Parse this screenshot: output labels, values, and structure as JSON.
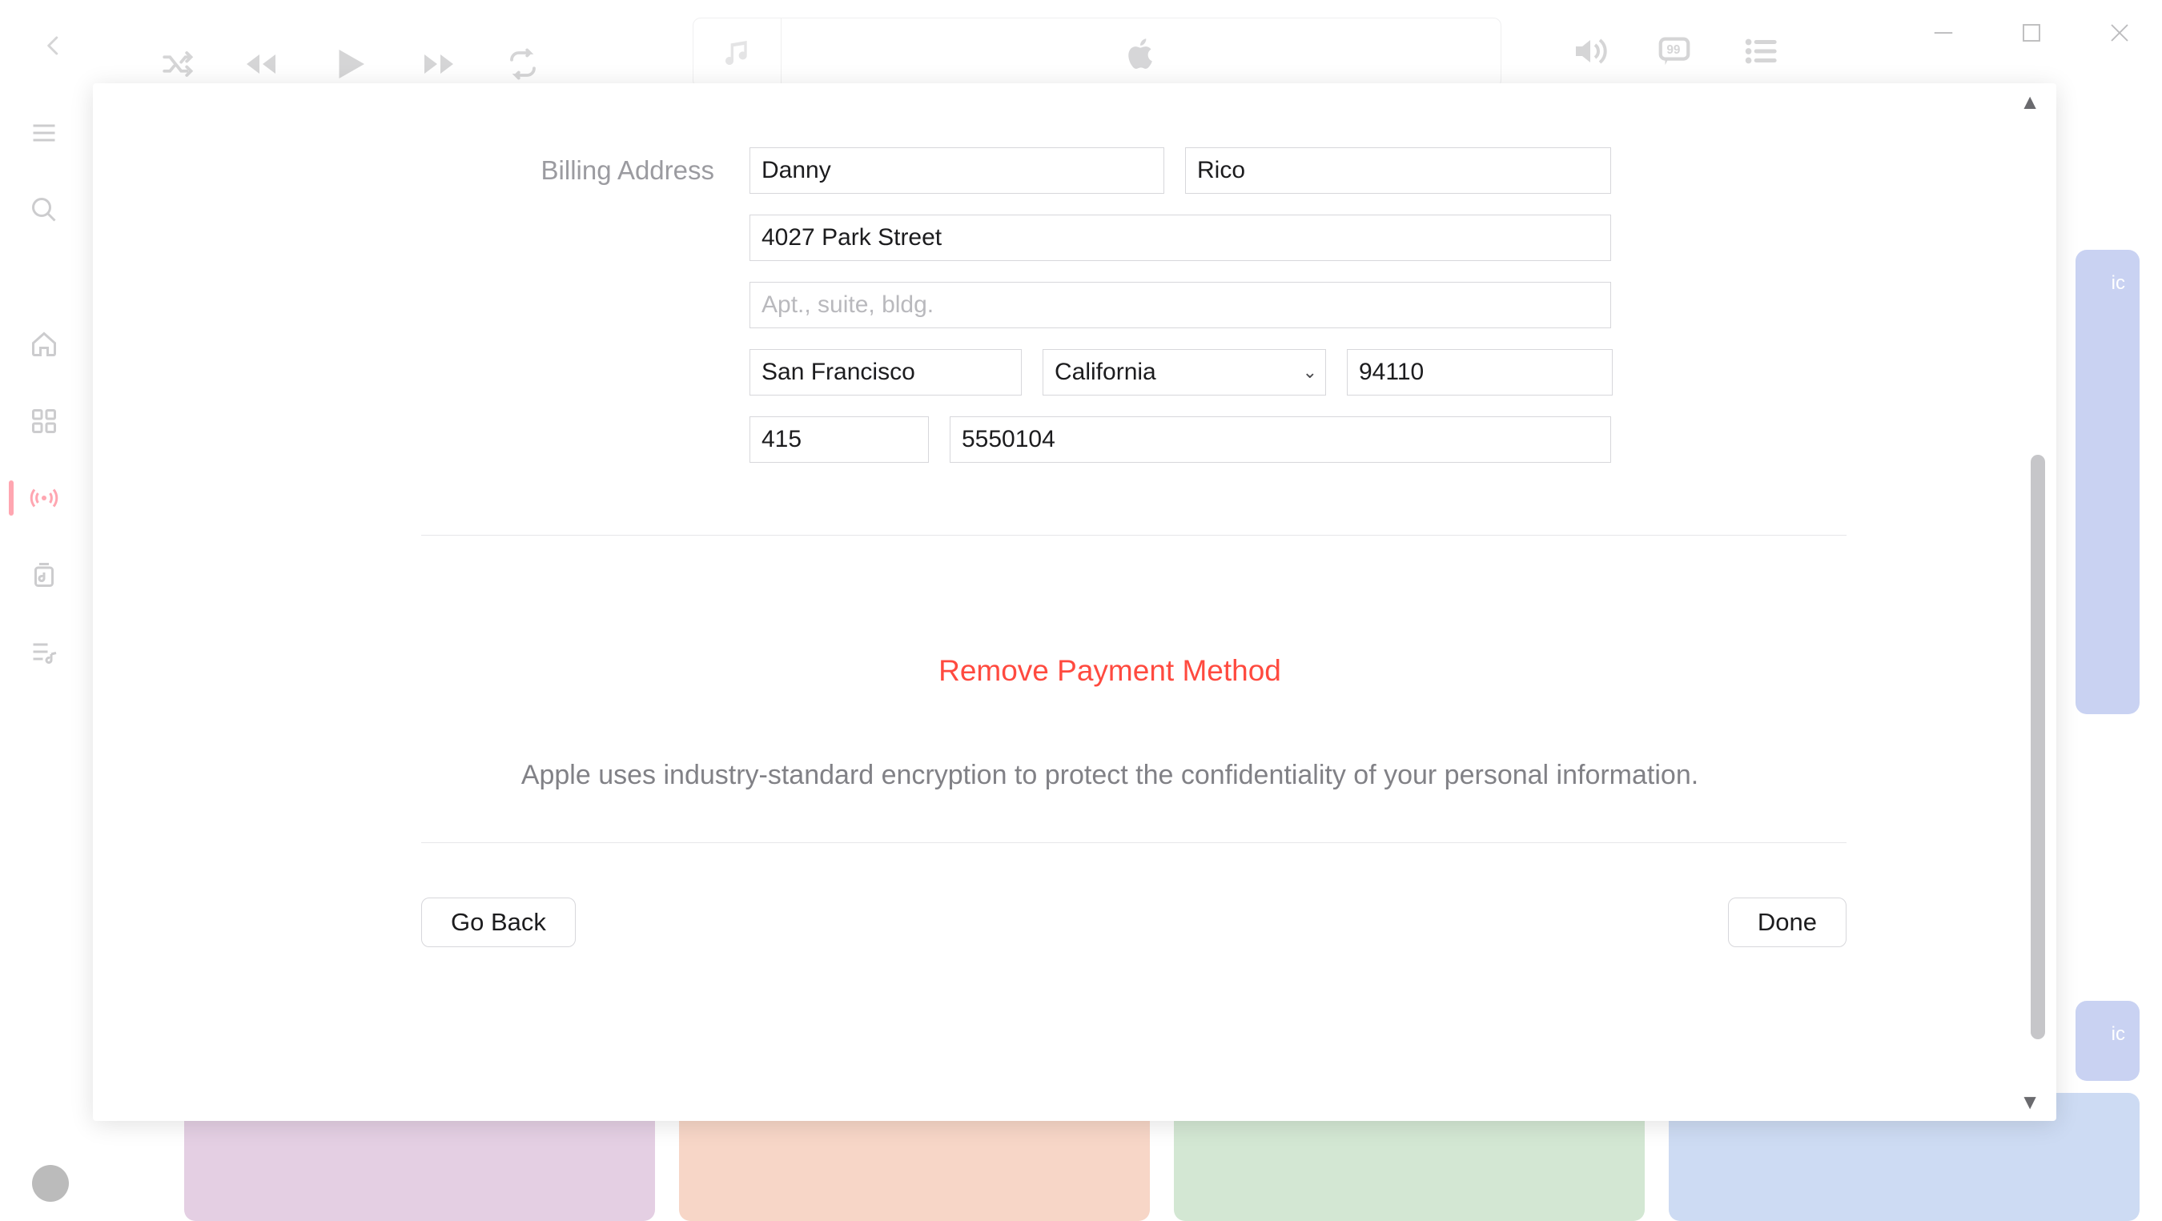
{
  "billing": {
    "section_label": "Billing Address",
    "first_name": "Danny",
    "last_name": "Rico",
    "street": "4027 Park Street",
    "apt_placeholder": "Apt., suite, bldg.",
    "apt": "",
    "city": "San Francisco",
    "state": "California",
    "zip": "94110",
    "area_code": "415",
    "phone": "5550104"
  },
  "actions": {
    "remove": "Remove Payment Method",
    "info": "Apple uses industry-standard encryption to protect the confidentiality of your personal information.",
    "go_back": "Go Back",
    "done": "Done"
  },
  "bg": {
    "side_label": "ic"
  }
}
